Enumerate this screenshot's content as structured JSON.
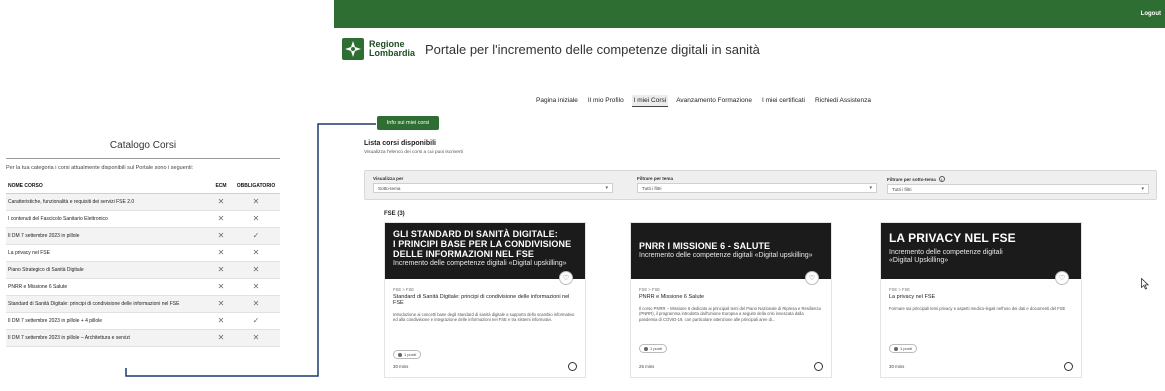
{
  "catalog": {
    "title": "Catalogo Corsi",
    "description": "Per la tua categoria i corsi attualmente disponibili sul Portale sono i seguenti:",
    "columns": [
      "NOME CORSO",
      "ECM",
      "OBBLIGATORIO"
    ],
    "rows": [
      {
        "name": "Caratteristiche, funzionalità e requisiti dei servizi FSE 2.0",
        "ecm": "✕",
        "obbligatorio": "✕"
      },
      {
        "name": "I contenuti del Fascicolo Sanitario Elettronico",
        "ecm": "✕",
        "obbligatorio": "✕"
      },
      {
        "name": "Il DM 7 settembre 2023 in pillole",
        "ecm": "✕",
        "obbligatorio": "✓"
      },
      {
        "name": "La privacy nel FSE",
        "ecm": "✕",
        "obbligatorio": "✕"
      },
      {
        "name": "Piano Strategico di Sanità Digitale",
        "ecm": "✕",
        "obbligatorio": "✕"
      },
      {
        "name": "PNRR e Missione 6 Salute",
        "ecm": "✕",
        "obbligatorio": "✕"
      },
      {
        "name": "Standard di Sanità Digitale: principi di condivisione delle informazioni nel FSE",
        "ecm": "✕",
        "obbligatorio": "✕"
      },
      {
        "name": "Il DM 7 settembre 2023 in pillole + 4 pillole",
        "ecm": "✕",
        "obbligatorio": "✓"
      },
      {
        "name": "Il DM 7 settembre 2023 in pillole – Architettura e servizi",
        "ecm": "✕",
        "obbligatorio": "✕"
      }
    ]
  },
  "portal": {
    "logout_label": "Logout",
    "brand": {
      "line1": "Regione",
      "line2": "Lombardia"
    },
    "title": "Portale per l'incremento delle competenze digitali in sanità",
    "nav": [
      {
        "label": "Pagina iniziale",
        "active": false
      },
      {
        "label": "Il mio Profilo",
        "active": false
      },
      {
        "label": "I miei Corsi",
        "active": true
      },
      {
        "label": "Avanzamento Formazione",
        "active": false
      },
      {
        "label": "I miei certificati",
        "active": false
      },
      {
        "label": "Richiedi Assistenza",
        "active": false
      }
    ],
    "info_button": "Info sui miei corsi",
    "list_title": "Lista corsi disponibili",
    "list_subtitle": "Visualizza l'elenco dei corsi a cui puoi iscriverti",
    "filters": [
      {
        "label": "Visualizza per",
        "value": "Sotto-tema",
        "has_info": false
      },
      {
        "label": "Filtrare per tema",
        "value": "Tutti i filtri",
        "has_info": false
      },
      {
        "label": "Filtrare per sotto-tema",
        "value": "Tutti i filtri",
        "has_info": true
      }
    ],
    "group_label": "FSE (3)",
    "cards": [
      {
        "banner_title": "GLI STANDARD DI SANITÀ DIGITALE:\nI PRINCIPI BASE PER LA CONDIVISIONE\nDELLE INFORMAZIONI NEL FSE",
        "banner_sub": "Incremento delle competenze digitali «Digital upskilling»",
        "tag": "FSE > FSE",
        "title": "Standard di Sanità Digitale: principi di condivisione delle informazioni nel FSE",
        "desc": "Introduzione ai concetti base degli standard di sanità digitale a supporto dello scambio informativo ed alla condivisione e integrazione delle informazioni nel FSE e tra sistemi informativi.",
        "ecm": "1 punti",
        "duration": "30 mins"
      },
      {
        "banner_title": "PNRR I MISSIONE 6 - SALUTE",
        "banner_sub": "Incremento delle competenze digitali «Digital upskilling»",
        "tag": "FSE > FSE",
        "title": "PNRR e Missione 6 Salute",
        "desc": "Il corso PNRR – Missione 6 dedicato ai principali temi del Piano Nazionale di Ripresa e Resilienza (PNRR), il programma introdotto dall'Unione Europea a seguito della crisi innescata dalla pandemia di COVID-19, con particolare attenzione alle principali aree di...",
        "ecm": "1 punti",
        "duration": "25 mins"
      },
      {
        "banner_title": "LA PRIVACY NEL FSE",
        "banner_sub": "Incremento delle competenze digitali\n«Digital Upskilling»",
        "tag": "FSE > FSE",
        "title": "La privacy nel FSE",
        "desc": "Formare sui principali temi privacy e aspetti medico-legali nell'uso dei dati e documenti del FSE",
        "ecm": "1 punti",
        "duration": "30 mins"
      }
    ]
  }
}
